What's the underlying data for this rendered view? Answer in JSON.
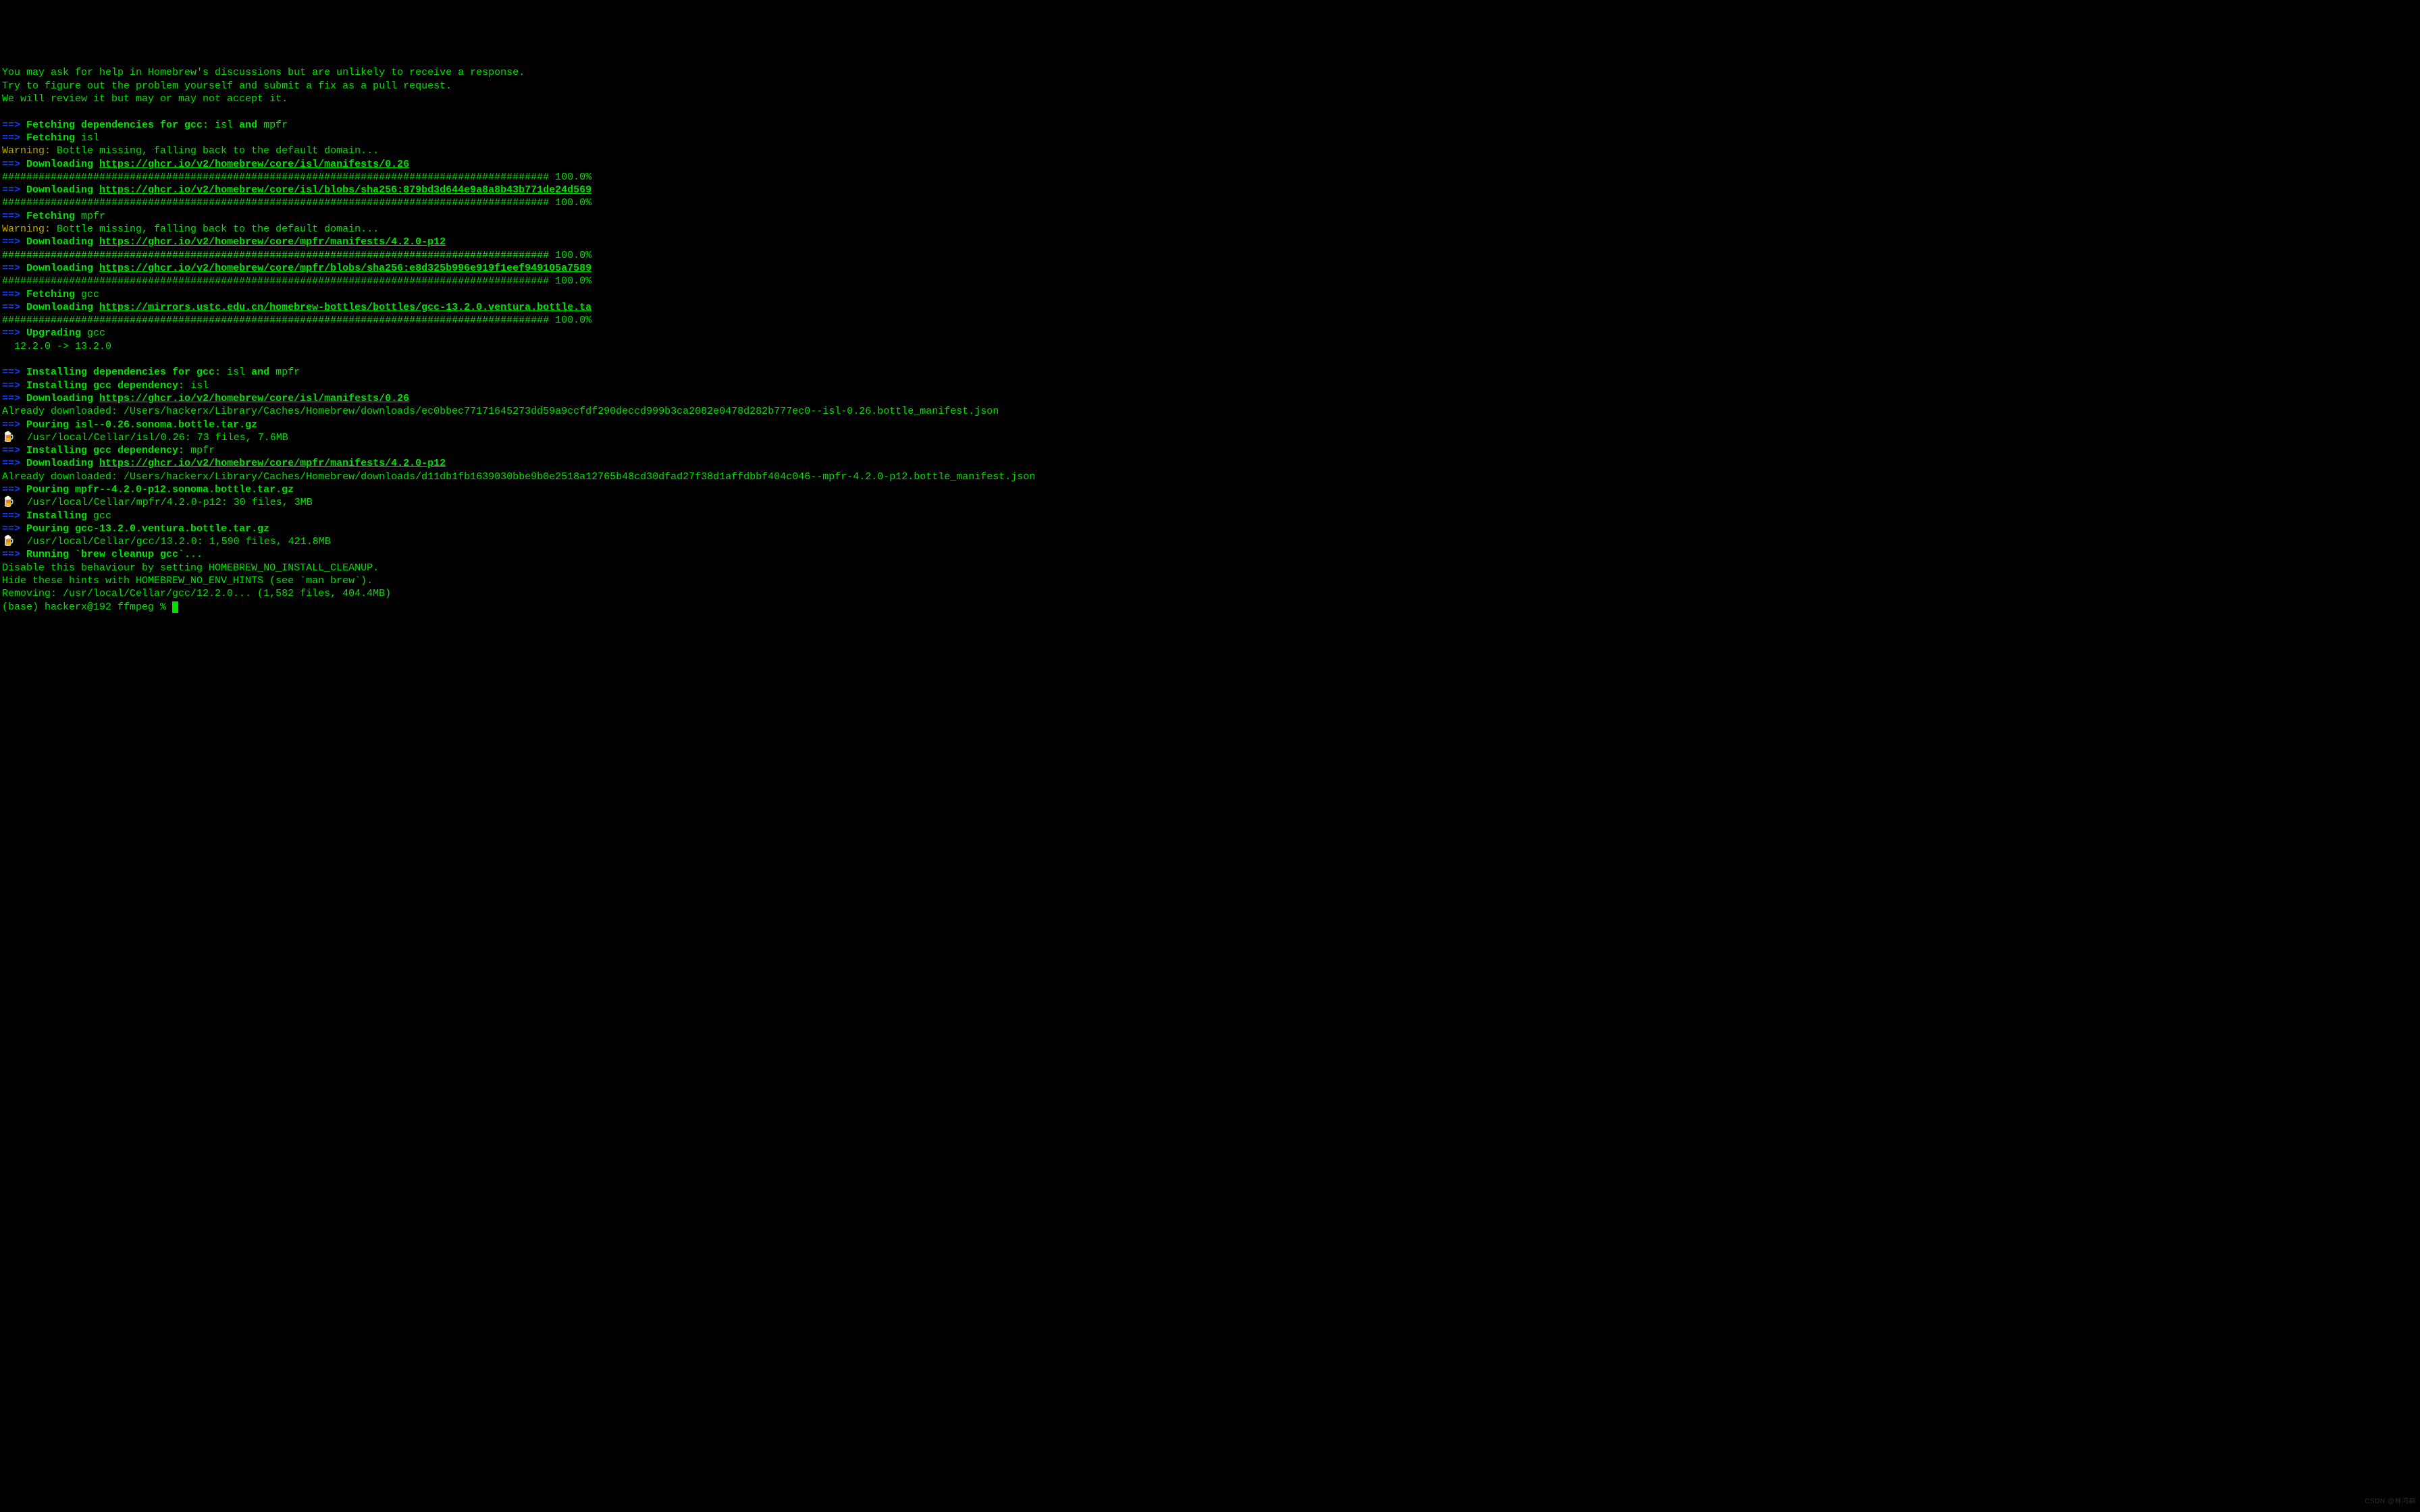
{
  "lines": {
    "l1": "You may ask for help in Homebrew's discussions but are unlikely to receive a response.",
    "l2": "Try to figure out the problem yourself and submit a fix as a pull request.",
    "l3": "We will review it but may or may not accept it.",
    "blank1": "",
    "arrow": "==> ",
    "fetch_deps_pre": "Fetching dependencies for gcc: ",
    "isl": "isl",
    "and": " and ",
    "mpfr": "mpfr",
    "fetching_sp": "Fetching ",
    "warning": "Warning:",
    "bottle_missing": " Bottle missing, falling back to the default domain...",
    "downloading_sp": "Downloading ",
    "url_isl_manifest": "https://ghcr.io/v2/homebrew/core/isl/manifests/0.26",
    "progress_bar": "########################################################################################## 100.0%",
    "url_isl_blob": "https://ghcr.io/v2/homebrew/core/isl/blobs/sha256:879bd3d644e9a8a8b43b771de24d569",
    "url_mpfr_manifest": "https://ghcr.io/v2/homebrew/core/mpfr/manifests/4.2.0-p12",
    "url_mpfr_blob": "https://ghcr.io/v2/homebrew/core/mpfr/blobs/sha256:e8d325b996e919f1eef949105a7589",
    "gcc": "gcc",
    "url_gcc_bottle": "https://mirrors.ustc.edu.cn/homebrew-bottles/bottles/gcc-13.2.0.ventura.bottle.ta",
    "upgrading_sp": "Upgrading ",
    "upgrade_versions": "  12.2.0 -> 13.2.0",
    "installing_deps_pre": "Installing dependencies for gcc: ",
    "installing_dep_pre": "Installing gcc dependency: ",
    "already_dl_isl": "Already downloaded: /Users/hackerx/Library/Caches/Homebrew/downloads/ec0bbec77171645273dd59a9ccfdf290deccd999b3ca2082e0478d282b777ec0--isl-0.26.bottle_manifest.json",
    "pouring_sp": "Pouring ",
    "pour_isl": "isl--0.26.sonoma.bottle.tar.gz",
    "beer": "🍺",
    "cellar_isl": "  /usr/local/Cellar/isl/0.26: 73 files, 7.6MB",
    "already_dl_mpfr": "Already downloaded: /Users/hackerx/Library/Caches/Homebrew/downloads/d11db1fb1639030bbe9b0e2518a12765b48cd30dfad27f38d1affdbbf404c046--mpfr-4.2.0-p12.bottle_manifest.json",
    "pour_mpfr": "mpfr--4.2.0-p12.sonoma.bottle.tar.gz",
    "cellar_mpfr": "  /usr/local/Cellar/mpfr/4.2.0-p12: 30 files, 3MB",
    "installing_sp": "Installing ",
    "pour_gcc": "gcc-13.2.0.ventura.bottle.tar.gz",
    "cellar_gcc": "  /usr/local/Cellar/gcc/13.2.0: 1,590 files, 421.8MB",
    "running_cleanup": "Running `brew cleanup gcc`...",
    "disable_hint": "Disable this behaviour by setting HOMEBREW_NO_INSTALL_CLEANUP.",
    "hide_hints": "Hide these hints with HOMEBREW_NO_ENV_HINTS (see `man brew`).",
    "removing": "Removing: /usr/local/Cellar/gcc/12.2.0... (1,582 files, 404.4MB)",
    "prompt": "(base) hackerx@192 ffmpeg % "
  },
  "watermark": "CSDN @林鸿群"
}
